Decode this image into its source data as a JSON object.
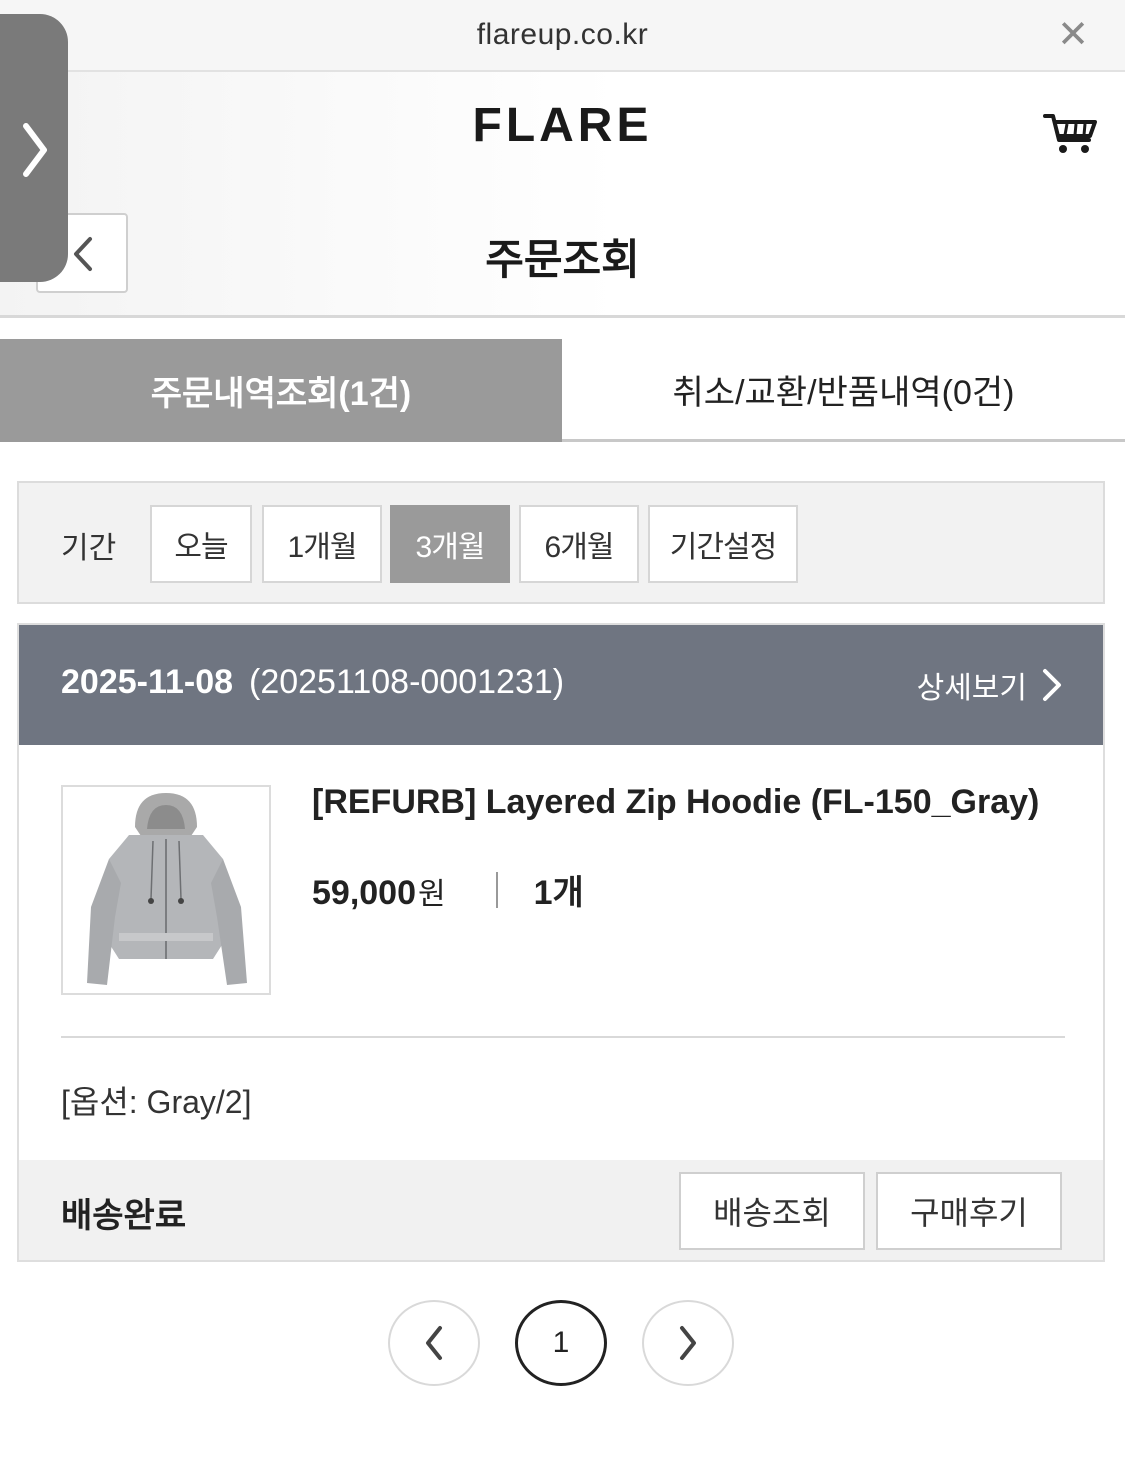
{
  "browser": {
    "url": "flareup.co.kr",
    "close_icon": "close-icon"
  },
  "header": {
    "logo": "FLARE",
    "cart_icon": "cart-icon",
    "back_icon": "chevron-left-icon",
    "title": "주문조회"
  },
  "side_panel": {
    "icon": "chevron-right-icon"
  },
  "tabs": [
    {
      "label": "주문내역조회(1건)",
      "active": true
    },
    {
      "label": "취소/교환/반품내역(0건)",
      "active": false
    }
  ],
  "period": {
    "label": "기간",
    "options": [
      "오늘",
      "1개월",
      "3개월",
      "6개월",
      "기간설정"
    ],
    "selected": "3개월"
  },
  "order": {
    "date": "2025-11-08",
    "number": "(20251108-0001231)",
    "detail_label": "상세보기",
    "product": {
      "name": "[REFURB] Layered Zip Hoodie (FL-150_Gray)",
      "price": "59,000",
      "currency": "원",
      "quantity": "1개",
      "option": "[옵션: Gray/2]"
    },
    "status": "배송완료",
    "buttons": {
      "tracking": "배송조회",
      "review": "구매후기"
    }
  },
  "pagination": {
    "current": "1",
    "prev_icon": "chevron-left-icon",
    "next_icon": "chevron-right-icon"
  },
  "colors": {
    "tab_active": "#9a9a9a",
    "order_header": "#6f7581",
    "accent_text": "#222222"
  }
}
